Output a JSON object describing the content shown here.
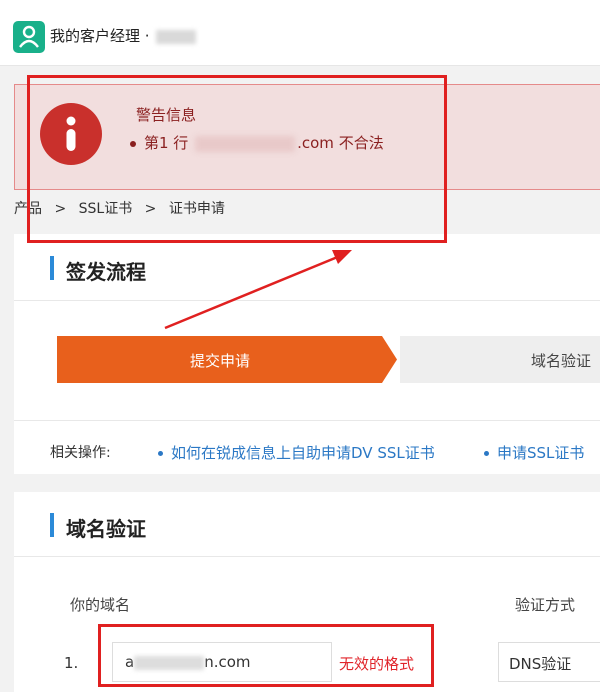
{
  "header": {
    "app_title": "我的客户经理 ·"
  },
  "alert": {
    "title": "警告信息",
    "message_prefix": "第1 行",
    "message_domain_suffix": ".com",
    "message_status": "不合法"
  },
  "breadcrumb": {
    "items": [
      "产品",
      ">",
      "SSL证书",
      ">",
      "证书申请"
    ]
  },
  "process": {
    "title": "签发流程",
    "steps": [
      {
        "label": "提交申请"
      },
      {
        "label": "域名验证"
      }
    ]
  },
  "related": {
    "label": "相关操作:",
    "links": [
      {
        "label": "如何在锐成信息上自助申请DV SSL证书"
      },
      {
        "label": "申请SSL证书"
      }
    ]
  },
  "verification": {
    "title": "域名验证",
    "col_domain": "你的域名",
    "col_method": "验证方式",
    "rows": [
      {
        "index": "1.",
        "domain_prefix": "a",
        "domain_suffix": "n.com",
        "error": "无效的格式",
        "method": "DNS验证"
      }
    ]
  },
  "colors": {
    "accent_orange": "#e8601c",
    "brand_green": "#19b08a",
    "error_red": "#e0242a",
    "link_blue": "#2b78c5"
  }
}
